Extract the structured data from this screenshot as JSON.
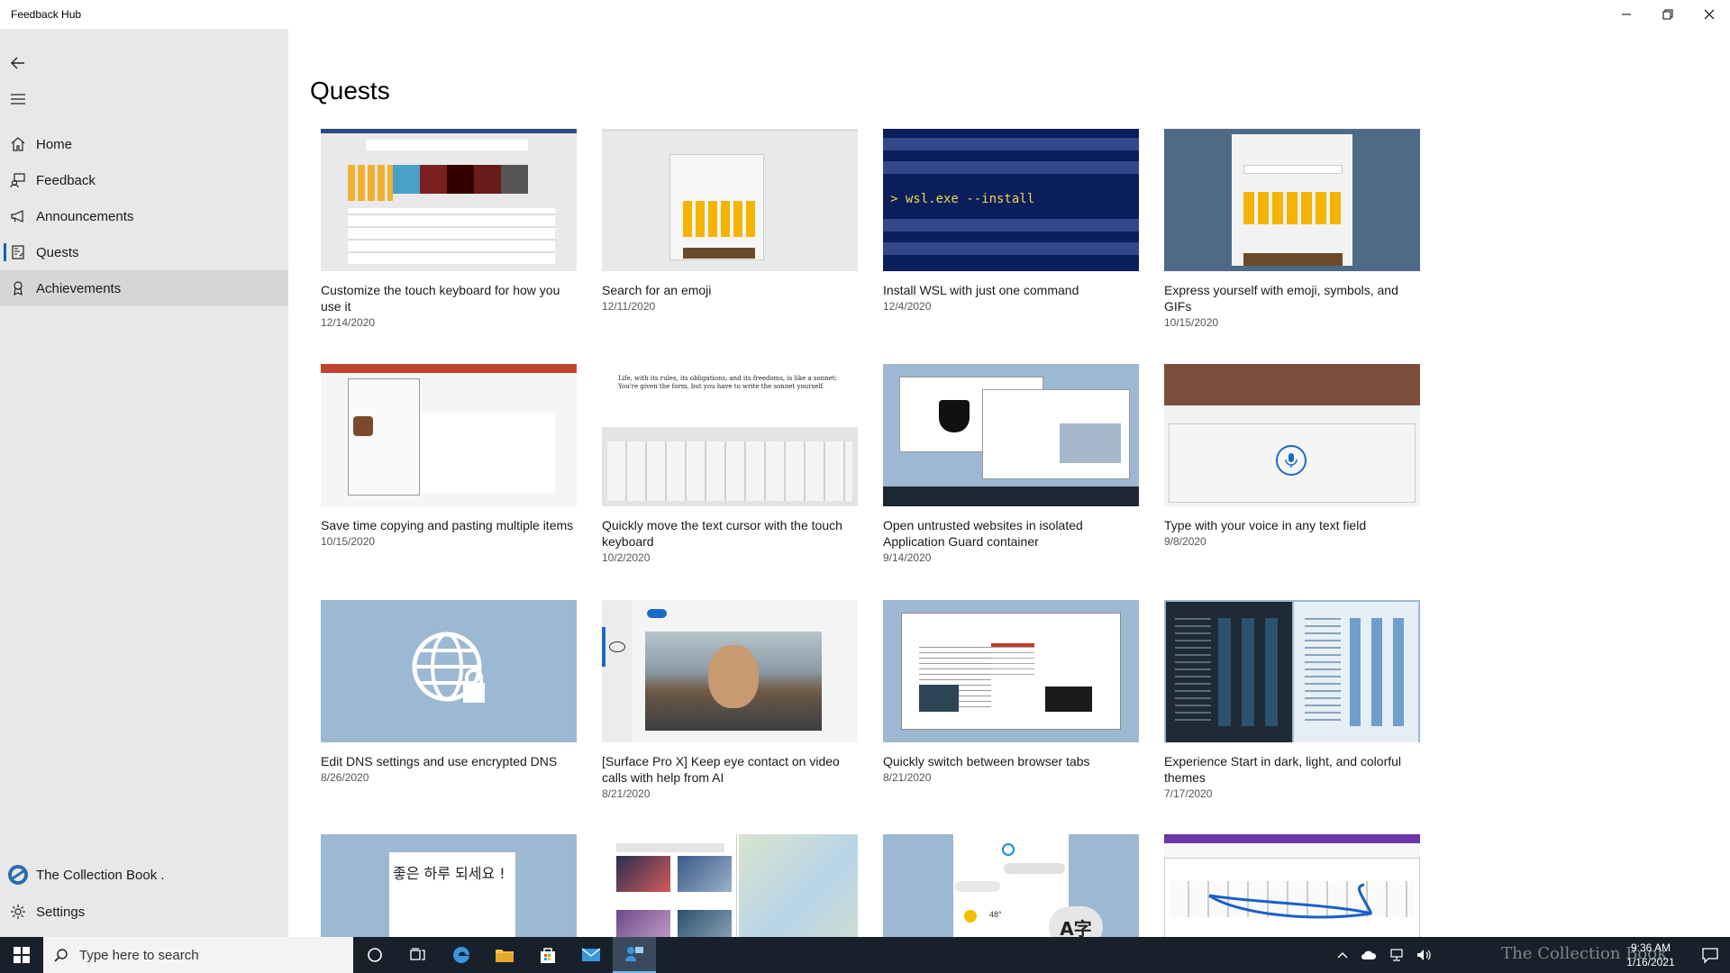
{
  "window": {
    "title": "Feedback Hub"
  },
  "sidebar": {
    "items": [
      {
        "label": "Home",
        "icon": "home-icon"
      },
      {
        "label": "Feedback",
        "icon": "feedback-icon"
      },
      {
        "label": "Announcements",
        "icon": "megaphone-icon"
      },
      {
        "label": "Quests",
        "icon": "quests-icon"
      },
      {
        "label": "Achievements",
        "icon": "achievements-icon"
      }
    ],
    "footer": [
      {
        "label": "The Collection Book .",
        "icon": "avatar-icon"
      },
      {
        "label": "Settings",
        "icon": "gear-icon"
      }
    ]
  },
  "main": {
    "title": "Quests",
    "cards": [
      {
        "title": "Customize the touch keyboard for how you use it",
        "date": "12/14/2020"
      },
      {
        "title": "Search for an emoji",
        "date": "12/11/2020"
      },
      {
        "title": "Install WSL with just one command",
        "date": "12/4/2020"
      },
      {
        "title": "Express yourself with emoji, symbols, and GIFs",
        "date": "10/15/2020"
      },
      {
        "title": "Save time copying and pasting multiple items",
        "date": "10/15/2020"
      },
      {
        "title": "Quickly move the text cursor with the touch keyboard",
        "date": "10/2/2020"
      },
      {
        "title": "Open untrusted websites in isolated Application Guard container",
        "date": "9/14/2020"
      },
      {
        "title": "Type with your voice in any text field",
        "date": "9/8/2020"
      },
      {
        "title": "Edit DNS settings and use encrypted DNS",
        "date": "8/26/2020"
      },
      {
        "title": "[Surface Pro X] Keep eye contact on video calls with help from AI",
        "date": "8/21/2020"
      },
      {
        "title": "Quickly switch between browser tabs",
        "date": "8/21/2020"
      },
      {
        "title": "Experience Start in dark, light, and colorful themes",
        "date": "7/17/2020"
      },
      {
        "title": "",
        "date": ""
      },
      {
        "title": "",
        "date": ""
      },
      {
        "title": "",
        "date": ""
      },
      {
        "title": "",
        "date": ""
      }
    ],
    "thumb_text": {
      "wsl_command": "> wsl.exe --install",
      "korean": "좋은 하루 되세요 !",
      "cursor_quote": "Life, with its rules, its obligations, and its freedoms, is like a sonnet: You're given the form, but you have to write the sonnet yourself.",
      "translate_glyph": "A字",
      "temp": "48°"
    }
  },
  "taskbar": {
    "search_placeholder": "Type here to search",
    "time": "9:36 AM",
    "date": "1/16/2021",
    "watermark": "The Collection Book"
  }
}
